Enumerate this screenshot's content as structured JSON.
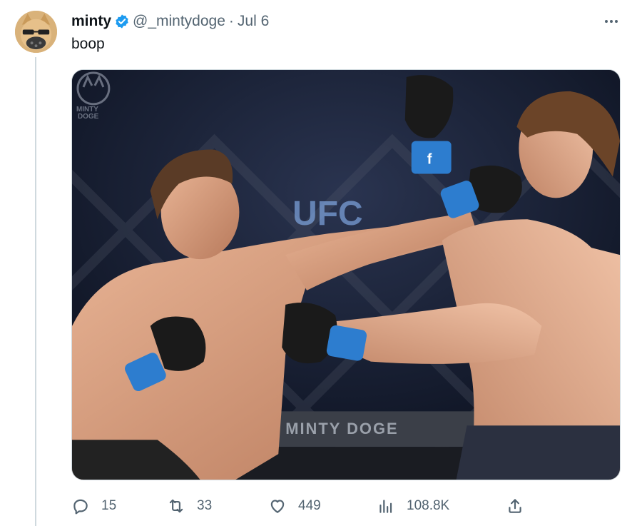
{
  "tweet": {
    "display_name": "minty",
    "handle": "@_mintydoge",
    "separator": "·",
    "date": "Jul 6",
    "text": "boop",
    "verified": true
  },
  "media": {
    "watermark_logo_text": "MINTY DOGE",
    "ring_sign_text": "MINTY DOGE",
    "arena_sign_text": "UFC",
    "glove_logo": "f"
  },
  "actions": {
    "reply_count": "15",
    "retweet_count": "33",
    "like_count": "449",
    "views_count": "108.8K"
  },
  "icons": {
    "more": "more-dots-icon",
    "verified": "verified-badge-icon",
    "reply": "reply-icon",
    "retweet": "retweet-icon",
    "like": "heart-icon",
    "views": "views-bar-chart-icon",
    "share": "share-upload-icon"
  },
  "colors": {
    "verified": "#1d9bf0",
    "secondary_text": "#536471",
    "primary_text": "#0f1419",
    "thread_line": "#cfd9de"
  }
}
